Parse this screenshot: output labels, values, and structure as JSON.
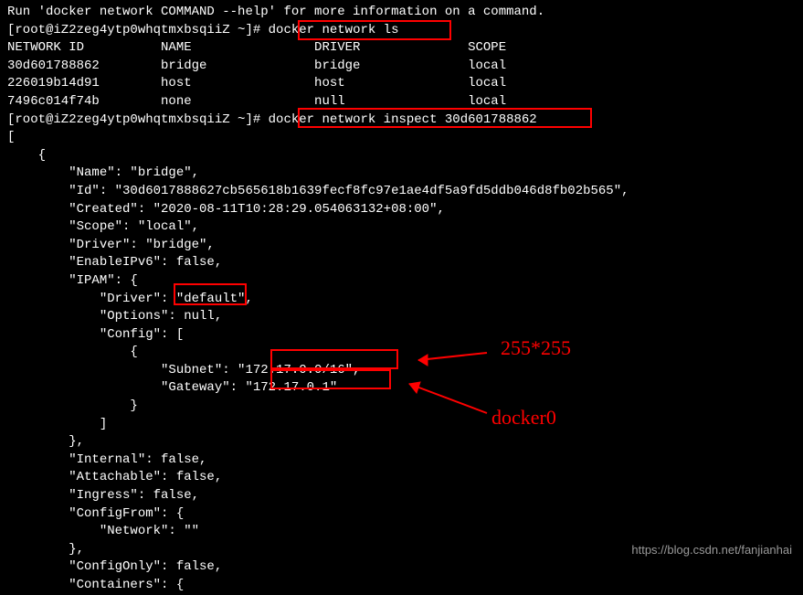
{
  "help_line": "Run 'docker network COMMAND --help' for more information on a command.",
  "prompt": "[root@iZ2zeg4ytp0whqtmxbsqiiZ ~]#",
  "cmd1": "docker network ls",
  "table_header": "NETWORK ID          NAME                DRIVER              SCOPE",
  "row1": "30d601788862        bridge              bridge              local",
  "row2": "226019b14d91        host                host                local",
  "row3": "7496c014f74b        none                null                local",
  "cmd2": "docker network inspect 30d601788862",
  "json_lines": [
    "[",
    "    {",
    "        \"Name\": \"bridge\",",
    "        \"Id\": \"30d6017888627cb565618b1639fecf8fc97e1ae4df5a9fd5ddb046d8fb02b565\",",
    "        \"Created\": \"2020-08-11T10:28:29.054063132+08:00\",",
    "        \"Scope\": \"local\",",
    "        \"Driver\": \"bridge\",",
    "        \"EnableIPv6\": false,",
    "        \"IPAM\": {",
    "            \"Driver\": \"default\",",
    "            \"Options\": null,",
    "            \"Config\": [",
    "                {",
    "                    \"Subnet\": \"172.17.0.0/16\",",
    "                    \"Gateway\": \"172.17.0.1\"",
    "                }",
    "            ]",
    "        },",
    "        \"Internal\": false,",
    "        \"Attachable\": false,",
    "        \"Ingress\": false,",
    "        \"ConfigFrom\": {",
    "            \"Network\": \"\"",
    "        },",
    "        \"ConfigOnly\": false,",
    "        \"Containers\": {"
  ],
  "annotation1": "255*255",
  "annotation2": "docker0",
  "watermark": "https://blog.csdn.net/fanjianhai"
}
